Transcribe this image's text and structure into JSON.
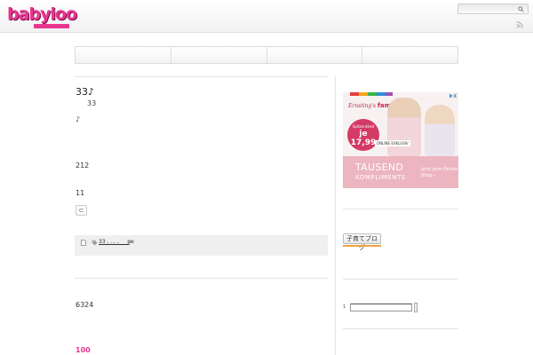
{
  "header": {
    "logo_text": "babyioo",
    "search_placeholder": ""
  },
  "nav": {
    "items": [
      "",
      "",
      "",
      ""
    ]
  },
  "post": {
    "title": "33♪",
    "subtitle": "33",
    "note": "♪",
    "line_212": "212",
    "line_11": "11",
    "small_button": "⊂",
    "tags": "33 , ... , __ ,",
    "line_6324": "6324",
    "line_100": "100"
  },
  "sidebar": {
    "ad": {
      "brand_prefix": "Ernsting's",
      "brand": "family",
      "badge_top": "Spitzenkleid",
      "badge_price": "je 17,99",
      "online_tag": "ONLINE EXKLUSIV",
      "headline": "TAUSEND",
      "headline2": "KOMPLIMENTE",
      "cta": "Jetzt zum Online Shop ›"
    },
    "blog_badge": "子育てブログ",
    "list_number": "1"
  },
  "colors": {
    "brand_pink": "#e8368f",
    "ad_pink": "#ecb5bf",
    "meta_bg": "#efefef"
  },
  "icons": {
    "search": "search-icon",
    "rss": "rss-icon",
    "doc": "document-icon",
    "tag": "tag-icon",
    "comment": "comment-icon"
  }
}
